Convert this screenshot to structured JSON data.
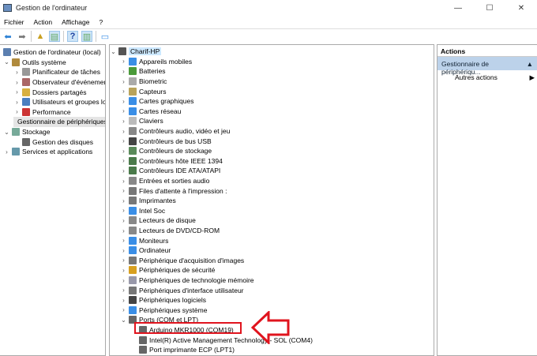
{
  "window": {
    "title": "Gestion de l'ordinateur",
    "minimize": "—",
    "maximize": "☐",
    "close": "✕"
  },
  "menu": [
    "Fichier",
    "Action",
    "Affichage",
    "?"
  ],
  "left_tree": [
    {
      "label": "Gestion de l'ordinateur (local)",
      "level": 0,
      "chev": "",
      "color": "#5b7fb0"
    },
    {
      "label": "Outils système",
      "level": 1,
      "chev": "v",
      "color": "#b08a3c"
    },
    {
      "label": "Planificateur de tâches",
      "level": 2,
      "chev": ">",
      "color": "#999"
    },
    {
      "label": "Observateur d'événements",
      "level": 2,
      "chev": ">",
      "color": "#a66"
    },
    {
      "label": "Dossiers partagés",
      "level": 2,
      "chev": ">",
      "color": "#d8b040"
    },
    {
      "label": "Utilisateurs et groupes locaux",
      "level": 2,
      "chev": ">",
      "color": "#4a7fc0"
    },
    {
      "label": "Performance",
      "level": 2,
      "chev": ">",
      "color": "#c33"
    },
    {
      "label": "Gestionnaire de périphériques",
      "level": 2,
      "chev": "",
      "color": "#555",
      "selected": true
    },
    {
      "label": "Stockage",
      "level": 1,
      "chev": "v",
      "color": "#7a9"
    },
    {
      "label": "Gestion des disques",
      "level": 2,
      "chev": "",
      "color": "#666"
    },
    {
      "label": "Services et applications",
      "level": 1,
      "chev": ">",
      "color": "#69a"
    }
  ],
  "device_tree": {
    "root": "Charif-HP",
    "categories": [
      {
        "label": "Appareils mobiles",
        "color": "#3a8ee6"
      },
      {
        "label": "Batteries",
        "color": "#4a9a3a"
      },
      {
        "label": "Biometric",
        "color": "#aaa"
      },
      {
        "label": "Capteurs",
        "color": "#b9a35a"
      },
      {
        "label": "Cartes graphiques",
        "color": "#3a8ee6"
      },
      {
        "label": "Cartes réseau",
        "color": "#3a8ee6"
      },
      {
        "label": "Claviers",
        "color": "#bbb"
      },
      {
        "label": "Contrôleurs audio, vidéo et jeu",
        "color": "#888"
      },
      {
        "label": "Contrôleurs de bus USB",
        "color": "#444"
      },
      {
        "label": "Contrôleurs de stockage",
        "color": "#5a8a5a"
      },
      {
        "label": "Contrôleurs hôte IEEE 1394",
        "color": "#4a7a4a"
      },
      {
        "label": "Contrôleurs IDE ATA/ATAPI",
        "color": "#4a7a4a"
      },
      {
        "label": "Entrées et sorties audio",
        "color": "#888"
      },
      {
        "label": "Files d'attente à l'impression :",
        "color": "#777"
      },
      {
        "label": "Imprimantes",
        "color": "#777"
      },
      {
        "label": "Intel Soc",
        "color": "#3a8ee6"
      },
      {
        "label": "Lecteurs de disque",
        "color": "#888"
      },
      {
        "label": "Lecteurs de DVD/CD-ROM",
        "color": "#888"
      },
      {
        "label": "Moniteurs",
        "color": "#3a8ee6"
      },
      {
        "label": "Ordinateur",
        "color": "#3a8ee6"
      },
      {
        "label": "Périphérique d'acquisition d'images",
        "color": "#777"
      },
      {
        "label": "Périphériques de sécurité",
        "color": "#d8a020"
      },
      {
        "label": "Périphériques de technologie mémoire",
        "color": "#99a"
      },
      {
        "label": "Périphériques d'interface utilisateur",
        "color": "#777"
      },
      {
        "label": "Périphériques logiciels",
        "color": "#444"
      },
      {
        "label": "Périphériques système",
        "color": "#3a8ee6"
      },
      {
        "label": "Ports (COM et LPT)",
        "color": "#666",
        "expanded": true
      }
    ],
    "ports": [
      "Arduino MKR1000 (COM19)",
      "Intel(R) Active Management Technology - SOL (COM4)",
      "Port imprimante ECP (LPT1)"
    ]
  },
  "actions": {
    "header": "Actions",
    "section": "Gestionnaire de périphériqu...",
    "more": "Autres actions"
  },
  "annotation_color": "#e0141e"
}
